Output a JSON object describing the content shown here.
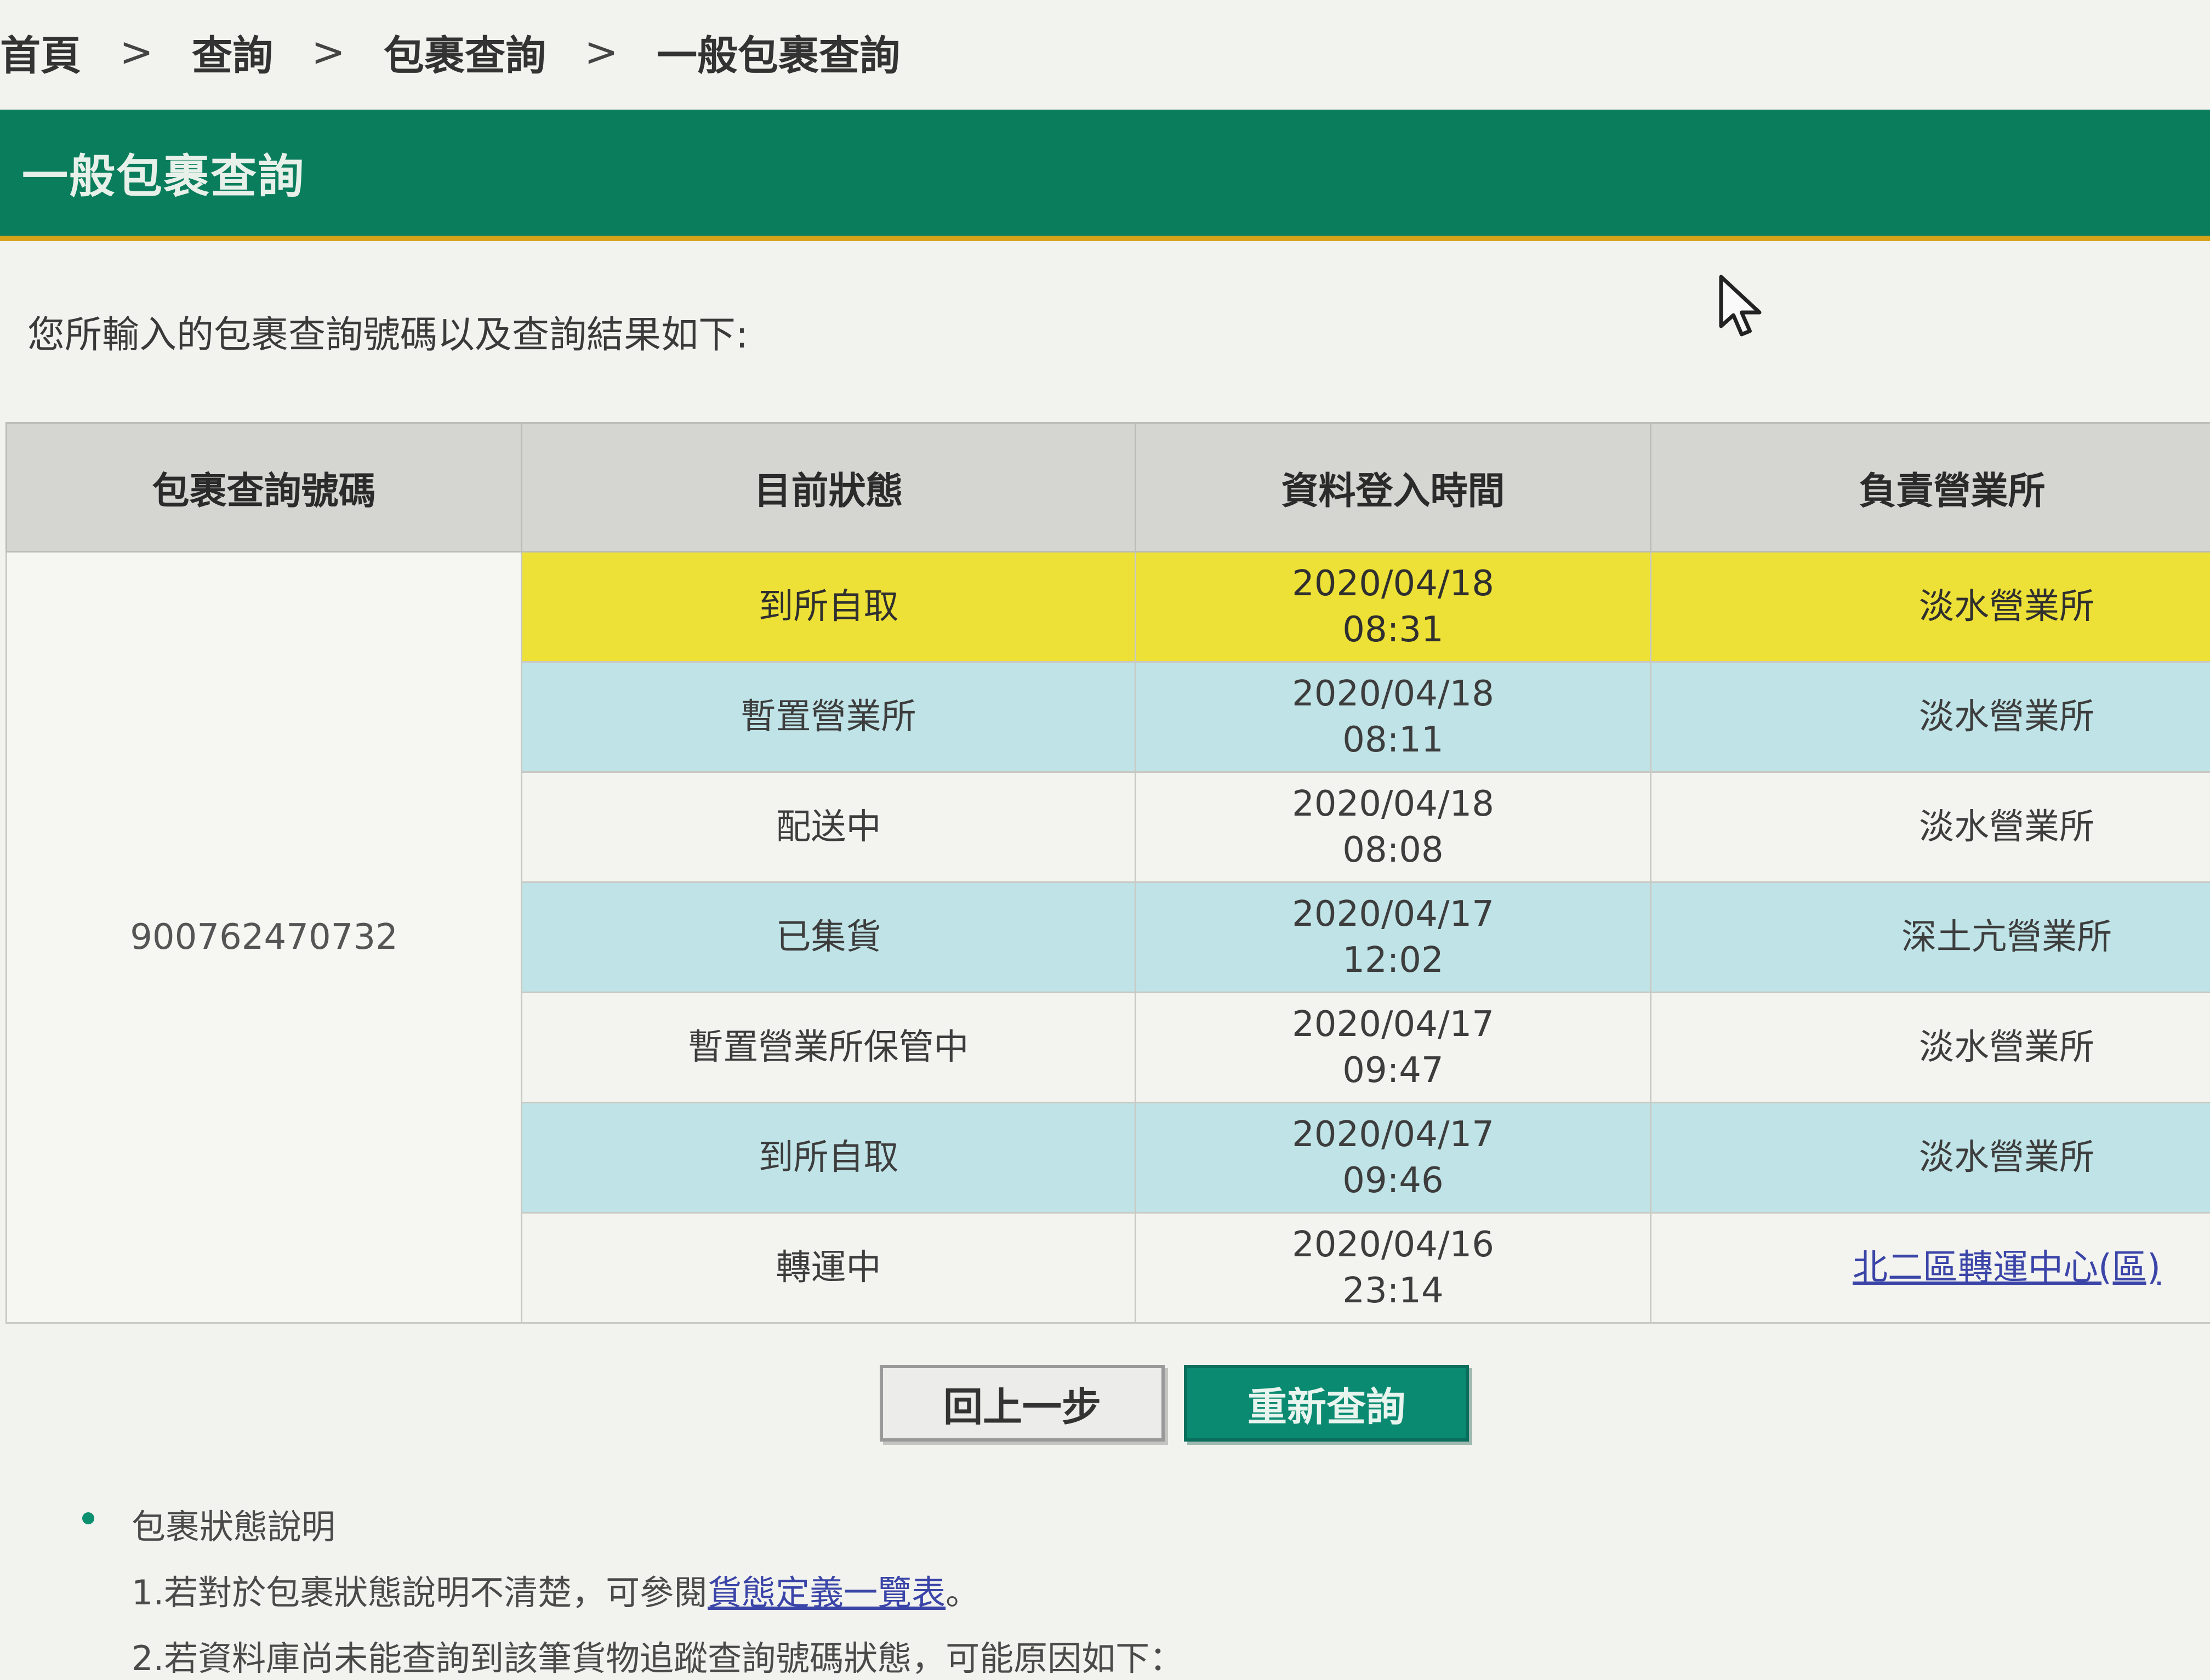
{
  "breadcrumb": {
    "items": [
      "首頁",
      "查詢",
      "包裹查詢",
      "一般包裹查詢"
    ],
    "separator": ">"
  },
  "header": {
    "title": "一般包裹查詢"
  },
  "intro_text": "您所輸入的包裹查詢號碼以及查詢結果如下:",
  "table": {
    "headers": [
      "包裹查詢號碼",
      "目前狀態",
      "資料登入時間",
      "負責營業所"
    ],
    "tracking_number": "900762470732",
    "rows": [
      {
        "status": "到所自取",
        "date": "2020/04/18",
        "time": "08:31",
        "office": "淡水營業所",
        "highlight": "yellow"
      },
      {
        "status": "暫置營業所",
        "date": "2020/04/18",
        "time": "08:11",
        "office": "淡水營業所",
        "highlight": "cyan"
      },
      {
        "status": "配送中",
        "date": "2020/04/18",
        "time": "08:08",
        "office": "淡水營業所",
        "highlight": "white"
      },
      {
        "status": "已集貨",
        "date": "2020/04/17",
        "time": "12:02",
        "office": "深土亢營業所",
        "highlight": "cyan"
      },
      {
        "status": "暫置營業所保管中",
        "date": "2020/04/17",
        "time": "09:47",
        "office": "淡水營業所",
        "highlight": "white"
      },
      {
        "status": "到所自取",
        "date": "2020/04/17",
        "time": "09:46",
        "office": "淡水營業所",
        "highlight": "cyan"
      },
      {
        "status": "轉運中",
        "date": "2020/04/16",
        "time": "23:14",
        "office": "北二區轉運中心(區)",
        "highlight": "white",
        "office_is_link": true
      }
    ]
  },
  "buttons": {
    "back": "回上一步",
    "requery": "重新查詢"
  },
  "notes": {
    "heading": "包裹狀態說明",
    "line1_prefix": "1.若對於包裹狀態說明不清楚，可參閱",
    "line1_link": "貨態定義一覽表",
    "line1_suffix": "。",
    "line2": "2.若資料庫尚未能查詢到該筆貨物追蹤查詢號碼狀態，可能原因如下："
  },
  "colors": {
    "header_green": "#0a7d5c",
    "highlight_yellow": "#ede036",
    "highlight_cyan": "#bfe3e6",
    "button_teal": "#0b8a72",
    "link_blue": "#3b45a8"
  }
}
